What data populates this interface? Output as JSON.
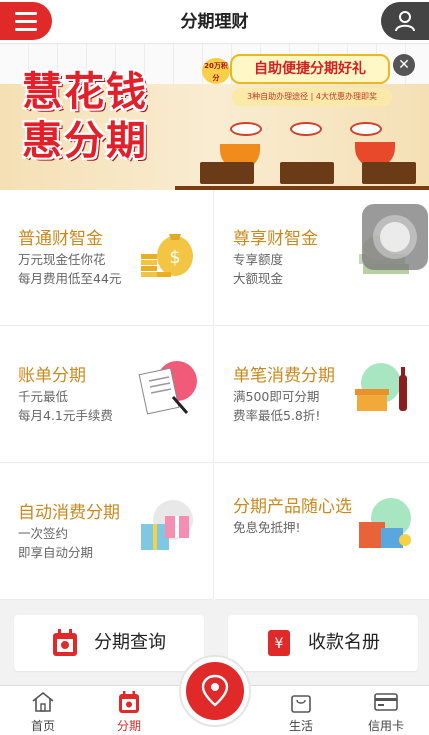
{
  "header": {
    "title": "分期理财"
  },
  "banner": {
    "line1": "慧花钱",
    "line2": "惠分期",
    "slogan": "自助便捷分期好礼",
    "sub_slogan": "3种自助办理途径 | 4大优惠办理即奖",
    "points_badge": "20万积分"
  },
  "cards": [
    {
      "title": "普通财智金",
      "desc1": "万元现金任你花",
      "desc2": "每月费用低至44元"
    },
    {
      "title": "尊享财智金",
      "desc1": "专享额度",
      "desc2": "大额现金"
    },
    {
      "title": "账单分期",
      "desc1": "千元最低",
      "desc2": "每月4.1元手续费"
    },
    {
      "title": "单笔消费分期",
      "desc1": "满500即可分期",
      "desc2": "费率最低5.8折!"
    },
    {
      "title": "自动消费分期",
      "desc1": "一次签约",
      "desc2": "即享自动分期"
    },
    {
      "title": "分期产品随心选",
      "desc1": "免息免抵押!",
      "desc2": ""
    }
  ],
  "quick_buttons": {
    "query_label": "分期查询",
    "roster_label": "收款名册"
  },
  "tabbar": {
    "home": "首页",
    "installment": "分期",
    "life": "生活",
    "credit_card": "信用卡"
  },
  "colors": {
    "brand_red": "#e02a2a",
    "gold_title": "#c88a1e"
  }
}
